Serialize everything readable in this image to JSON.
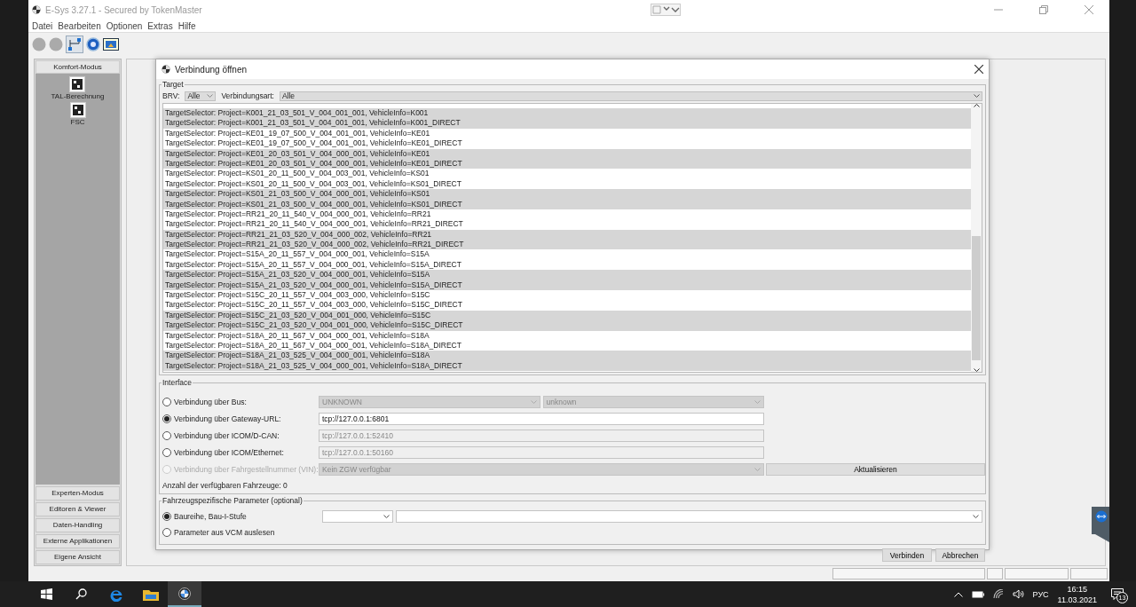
{
  "app": {
    "title": "E-Sys 3.27.1 - Secured by TokenMaster",
    "menu": [
      "Datei",
      "Bearbeiten",
      "Optionen",
      "Extras",
      "Hilfe"
    ]
  },
  "sidebar": {
    "header": "Komfort-Modus",
    "tools": [
      "TAL-Berechnung",
      "FSC"
    ],
    "sections": [
      "Experten-Modus",
      "Editoren & Viewer",
      "Daten-Handling",
      "Externe Applikationen",
      "Eigene Ansicht"
    ]
  },
  "dialog": {
    "title": "Verbindung öffnen",
    "target": {
      "legend": "Target",
      "brv_label": "BRV:",
      "brv_value": "Alle",
      "type_label": "Verbindungsart:",
      "type_value": "Alle",
      "rows": [
        {
          "text": "TargetSelector: Project=K001_21_03_501_V_004_001_001, VehicleInfo=K001",
          "shaded": true
        },
        {
          "text": "TargetSelector: Project=K001_21_03_501_V_004_001_001, VehicleInfo=K001_DIRECT",
          "shaded": true
        },
        {
          "text": "TargetSelector: Project=KE01_19_07_500_V_004_001_001, VehicleInfo=KE01",
          "shaded": false
        },
        {
          "text": "TargetSelector: Project=KE01_19_07_500_V_004_001_001, VehicleInfo=KE01_DIRECT",
          "shaded": false
        },
        {
          "text": "TargetSelector: Project=KE01_20_03_501_V_004_000_001, VehicleInfo=KE01",
          "shaded": true
        },
        {
          "text": "TargetSelector: Project=KE01_20_03_501_V_004_000_001, VehicleInfo=KE01_DIRECT",
          "shaded": true
        },
        {
          "text": "TargetSelector: Project=KS01_20_11_500_V_004_003_001, VehicleInfo=KS01",
          "shaded": false
        },
        {
          "text": "TargetSelector: Project=KS01_20_11_500_V_004_003_001, VehicleInfo=KS01_DIRECT",
          "shaded": false
        },
        {
          "text": "TargetSelector: Project=KS01_21_03_500_V_004_000_001, VehicleInfo=KS01",
          "shaded": true
        },
        {
          "text": "TargetSelector: Project=KS01_21_03_500_V_004_000_001, VehicleInfo=KS01_DIRECT",
          "shaded": true
        },
        {
          "text": "TargetSelector: Project=RR21_20_11_540_V_004_000_001, VehicleInfo=RR21",
          "shaded": false
        },
        {
          "text": "TargetSelector: Project=RR21_20_11_540_V_004_000_001, VehicleInfo=RR21_DIRECT",
          "shaded": false
        },
        {
          "text": "TargetSelector: Project=RR21_21_03_520_V_004_000_002, VehicleInfo=RR21",
          "shaded": true
        },
        {
          "text": "TargetSelector: Project=RR21_21_03_520_V_004_000_002, VehicleInfo=RR21_DIRECT",
          "shaded": true
        },
        {
          "text": "TargetSelector: Project=S15A_20_11_557_V_004_000_001, VehicleInfo=S15A",
          "shaded": false
        },
        {
          "text": "TargetSelector: Project=S15A_20_11_557_V_004_000_001, VehicleInfo=S15A_DIRECT",
          "shaded": false
        },
        {
          "text": "TargetSelector: Project=S15A_21_03_520_V_004_000_001, VehicleInfo=S15A",
          "shaded": true
        },
        {
          "text": "TargetSelector: Project=S15A_21_03_520_V_004_000_001, VehicleInfo=S15A_DIRECT",
          "shaded": true
        },
        {
          "text": "TargetSelector: Project=S15C_20_11_557_V_004_003_000, VehicleInfo=S15C",
          "shaded": false
        },
        {
          "text": "TargetSelector: Project=S15C_20_11_557_V_004_003_000, VehicleInfo=S15C_DIRECT",
          "shaded": false
        },
        {
          "text": "TargetSelector: Project=S15C_21_03_520_V_004_001_000, VehicleInfo=S15C",
          "shaded": true
        },
        {
          "text": "TargetSelector: Project=S15C_21_03_520_V_004_001_000, VehicleInfo=S15C_DIRECT",
          "shaded": true
        },
        {
          "text": "TargetSelector: Project=S18A_20_11_567_V_004_000_001, VehicleInfo=S18A",
          "shaded": false
        },
        {
          "text": "TargetSelector: Project=S18A_20_11_567_V_004_000_001, VehicleInfo=S18A_DIRECT",
          "shaded": false
        },
        {
          "text": "TargetSelector: Project=S18A_21_03_525_V_004_000_001, VehicleInfo=S18A",
          "shaded": true
        },
        {
          "text": "TargetSelector: Project=S18A_21_03_525_V_004_000_001, VehicleInfo=S18A_DIRECT",
          "shaded": true
        }
      ]
    },
    "interface": {
      "legend": "Interface",
      "options": [
        {
          "kind": "dual-select",
          "label": "Verbindung über Bus:",
          "selected": false,
          "disabled": false,
          "values": [
            "UNKNOWN",
            "unknown"
          ]
        },
        {
          "kind": "field",
          "label": "Verbindung über Gateway-URL:",
          "selected": true,
          "disabled": false,
          "value": "tcp://127.0.0.1:6801",
          "editable": true
        },
        {
          "kind": "field",
          "label": "Verbindung über ICOM/D-CAN:",
          "selected": false,
          "disabled": false,
          "value": "tcp://127.0.0.1:52410",
          "editable": false
        },
        {
          "kind": "field",
          "label": "Verbindung über ICOM/Ethernet:",
          "selected": false,
          "disabled": false,
          "value": "tcp://127.0.0.1:50160",
          "editable": false
        },
        {
          "kind": "select-button",
          "label": "Verbindung über Fahrgestellnummer (VIN):",
          "selected": false,
          "disabled": true,
          "value": "Kein ZGW verfügbar",
          "button": "Aktualisieren"
        }
      ],
      "count_text": "Anzahl der verfügbaren Fahrzeuge: 0"
    },
    "vehicle_params": {
      "legend": "Fahrzeugspezifische Parameter (optional)",
      "options": [
        {
          "kind": "selects",
          "label": "Baureihe, Bau-I-Stufe",
          "selected": true
        },
        {
          "kind": "plain",
          "label": "Parameter aus VCM auslesen",
          "selected": false
        }
      ]
    },
    "buttons": [
      "Verbinden",
      "Abbrechen"
    ]
  },
  "taskbar": {
    "language": "РУС",
    "time": "16:15",
    "date": "11.03.2021",
    "notifications": "13"
  }
}
